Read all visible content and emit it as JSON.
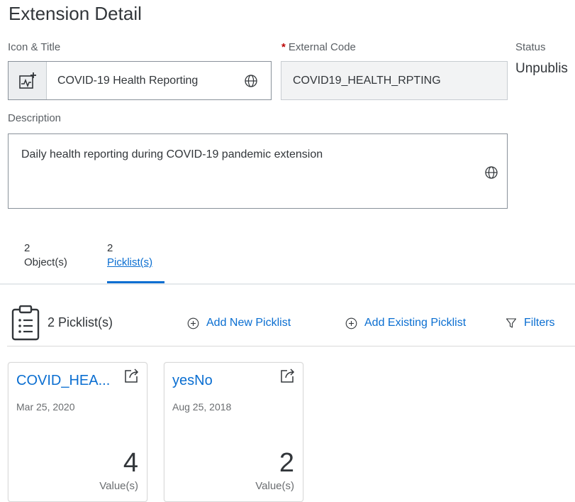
{
  "page": {
    "title": "Extension Detail"
  },
  "fields": {
    "icon_title": {
      "label": "Icon & Title",
      "value": "COVID-19 Health Reporting",
      "icon": "chart-add-icon",
      "translate_icon": "globe-icon"
    },
    "external_code": {
      "label": "External Code",
      "required_marker": "*",
      "value": "COVID19_HEALTH_RPTING"
    },
    "status": {
      "label": "Status",
      "value": "Unpublis"
    },
    "description": {
      "label": "Description",
      "value": "Daily health reporting during COVID-19 pandemic extension",
      "translate_icon": "globe-icon"
    }
  },
  "tabs": [
    {
      "count": "2",
      "label": "Object(s)",
      "selected": false
    },
    {
      "count": "2",
      "label": "Picklist(s)",
      "selected": true
    }
  ],
  "picklists_section": {
    "icon": "clipboard-list-icon",
    "count_label": "2 Picklist(s)",
    "add_new": "Add New Picklist",
    "add_existing": "Add Existing Picklist",
    "filters": "Filters"
  },
  "cards": [
    {
      "title": "COVID_HEA...",
      "date": "Mar 25, 2020",
      "value": "4",
      "unit": "Value(s)",
      "icon": "open-external-icon"
    },
    {
      "title": "yesNo",
      "date": "Aug 25, 2018",
      "value": "2",
      "unit": "Value(s)",
      "icon": "open-external-icon"
    }
  ],
  "colors": {
    "accent": "#0a6ed1",
    "required": "#bb0000",
    "text": "#32363a",
    "muted": "#6a6d70"
  }
}
